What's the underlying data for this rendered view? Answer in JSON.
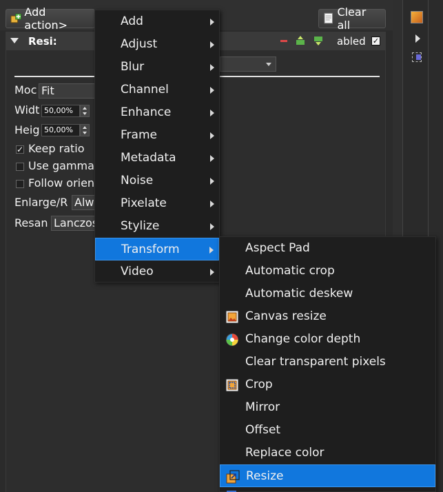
{
  "toolbar": {
    "add_action_label": "Add action>",
    "clear_all_label": "Clear all"
  },
  "panel": {
    "title": "Resi:",
    "enabled_label": "abled",
    "enabled_checked": "✓",
    "form": {
      "mode_label": "Moc",
      "mode_value": "Fit",
      "width_label": "Widt",
      "width_value": "50,00%",
      "height_label": "Heig",
      "height_value": "50,00%",
      "keep_ratio_label": "Keep ratio",
      "keep_ratio_checked": "✓",
      "use_gamma_label": "Use gamma c",
      "follow_orient_label": "Follow orient",
      "enlarge_label": "Enlarge/R",
      "enlarge_value": "Alwa",
      "resample_label": "Resan",
      "resample_value": "Lanczos"
    }
  },
  "menu": {
    "items": [
      {
        "label": "Add"
      },
      {
        "label": "Adjust"
      },
      {
        "label": "Blur"
      },
      {
        "label": "Channel"
      },
      {
        "label": "Enhance"
      },
      {
        "label": "Frame"
      },
      {
        "label": "Metadata"
      },
      {
        "label": "Noise"
      },
      {
        "label": "Pixelate"
      },
      {
        "label": "Stylize"
      },
      {
        "label": "Transform"
      },
      {
        "label": "Video"
      }
    ],
    "selected": "Transform"
  },
  "submenu": {
    "items": [
      {
        "label": "Aspect Pad",
        "icon": ""
      },
      {
        "label": "Automatic crop",
        "icon": ""
      },
      {
        "label": "Automatic deskew",
        "icon": ""
      },
      {
        "label": "Canvas resize",
        "icon": "canvas-resize-icon"
      },
      {
        "label": "Change color depth",
        "icon": "color-depth-icon"
      },
      {
        "label": "Clear transparent pixels",
        "icon": ""
      },
      {
        "label": "Crop",
        "icon": "crop-icon"
      },
      {
        "label": "Mirror",
        "icon": ""
      },
      {
        "label": "Offset",
        "icon": ""
      },
      {
        "label": "Replace color",
        "icon": ""
      },
      {
        "label": "Resize",
        "icon": "resize-icon"
      }
    ],
    "selected": "Resize"
  },
  "colors": {
    "menu_bg": "#1e1e1e",
    "highlight": "#1177dd",
    "panel_bg": "#2d2d2d"
  }
}
